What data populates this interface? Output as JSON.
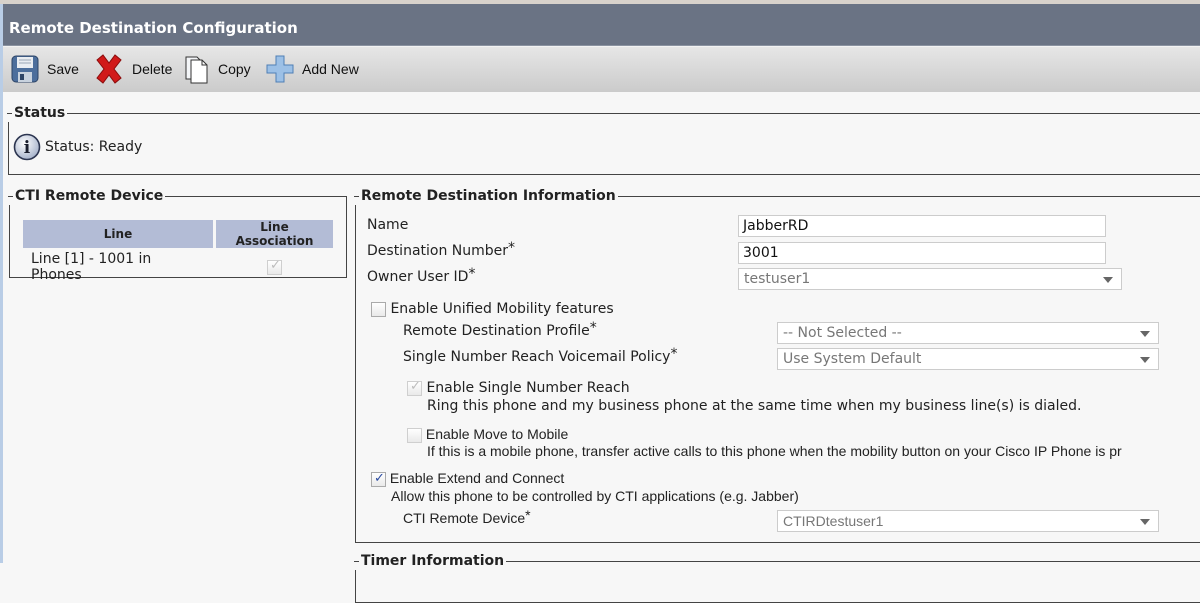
{
  "header": {
    "title": "Remote Destination Configuration"
  },
  "toolbar": {
    "save_label": "Save",
    "delete_label": "Delete",
    "copy_label": "Copy",
    "add_new_label": "Add New"
  },
  "status": {
    "legend": "Status",
    "text": "Status: Ready"
  },
  "cti_remote_device_panel": {
    "legend": "CTI Remote Device",
    "columns": [
      "Line",
      "Line Association"
    ],
    "rows": [
      {
        "line": "Line [1] - 1001 in Phones",
        "associated": true
      }
    ]
  },
  "remote_destination_info": {
    "legend": "Remote Destination Information",
    "name_label": "Name",
    "name_value": "JabberRD",
    "destination_number_label": "Destination Number",
    "destination_number_value": "3001",
    "owner_user_id_label": "Owner User ID",
    "owner_user_id_value": "testuser1",
    "required_mark": "*",
    "enable_unified_mobility_label": "Enable Unified Mobility features",
    "enable_unified_mobility_checked": false,
    "remote_destination_profile_label": "Remote Destination Profile",
    "remote_destination_profile_value": "-- Not Selected --",
    "snr_voicemail_policy_label": "Single Number Reach Voicemail Policy",
    "snr_voicemail_policy_value": "Use System Default",
    "enable_snr_label": "Enable Single Number Reach",
    "enable_snr_checked": true,
    "enable_snr_desc": "Ring this phone and my business phone at the same time when my business line(s) is dialed.",
    "enable_move_to_mobile_label": "Enable Move to Mobile",
    "enable_move_to_mobile_checked": false,
    "enable_move_to_mobile_desc": "If this is a mobile phone, transfer active calls to this phone when the mobility button on your Cisco IP Phone is pr",
    "enable_extend_connect_label": "Enable Extend and Connect",
    "enable_extend_connect_checked": true,
    "enable_extend_connect_desc": "Allow this phone to be controlled by CTI applications (e.g. Jabber)",
    "cti_remote_device_label": "CTI Remote Device",
    "cti_remote_device_value": "CTIRDtestuser1"
  },
  "timer_info": {
    "legend": "Timer Information"
  }
}
